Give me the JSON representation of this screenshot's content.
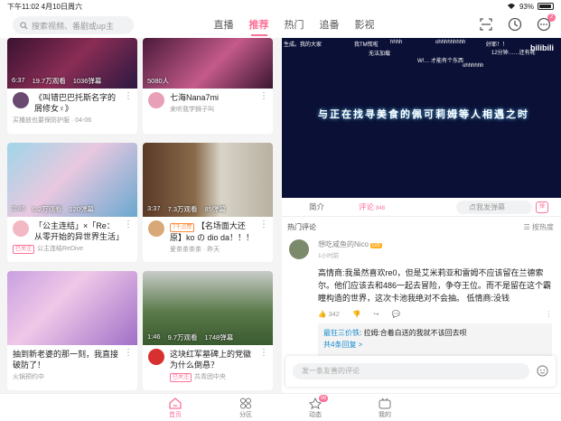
{
  "status_bar": {
    "time_date": "下午11:02   4月10日周六",
    "battery": "93%",
    "battery_level": 0.93
  },
  "search": {
    "placeholder": "搜索视频、番剧或up主"
  },
  "top_tabs": [
    {
      "label": "直播",
      "active": false
    },
    {
      "label": "推荐",
      "active": true
    },
    {
      "label": "热门",
      "active": false
    },
    {
      "label": "追番",
      "active": false
    },
    {
      "label": "影视",
      "active": false
    }
  ],
  "top_icons": {
    "message_badge": "2"
  },
  "feed": [
    {
      "views": "19.7万观看",
      "danmaku": "1036弹幕",
      "duration": "6:37",
      "title": "《叫错巴巴托斯名字的屑修女♀》",
      "sub": "买播放也要保防护服 · 04-06",
      "tag": ""
    },
    {
      "views": "5080人",
      "danmaku": "",
      "duration": "",
      "title": "七海Nana7mi",
      "sub": "来听我学狮子叫",
      "tag": ""
    },
    {
      "views": "6.2万观看",
      "danmaku": "120弹幕",
      "duration": "0:46",
      "title": "「公主连结」×「Re：从零开始的异世界生活」",
      "sub": "公主连结ReDive",
      "tag": "已关注"
    },
    {
      "views": "7.3万观看",
      "danmaku": "85弹幕",
      "duration": "3:37",
      "title": "【名场面大还原】ko の dio da！！！",
      "sub": "爱茶茶茶茶 · 昨天",
      "tag": "7千点赞"
    },
    {
      "views": "",
      "danmaku": "",
      "duration": "",
      "title": "抽到新老婆的那一刻，我直接破防了！",
      "sub": "火锅预约中",
      "tag": ""
    },
    {
      "views": "9.7万观看",
      "danmaku": "1748弹幕",
      "duration": "1:46",
      "title": "这块红军墓碑上的党徽为什么倒悬？",
      "sub": "共青团中央",
      "tag": "已关注"
    }
  ],
  "player": {
    "subtitle": "与正在找寻美食的佩可莉姆等人相遇之时",
    "logo": "bilibili",
    "danmaku": [
      "生成。我的大家",
      "我TM慌啦",
      "hhhh",
      "ohhhhhhhhh",
      "好耶！！",
      "无法加载",
      "12分钟……还有呢",
      "W!… 才能有个东西",
      "ohhhhhh"
    ]
  },
  "player_tabs": {
    "intro": "简介",
    "comments": "评论",
    "comments_count": "848",
    "danmaku_placeholder": "点我发弹幕",
    "danmaku_toggle": "弹"
  },
  "comments": {
    "header": "热门评论",
    "sort": "按热度",
    "items": [
      {
        "user": "想吃咸鱼的Nico",
        "level": "LV5",
        "time": "1小时前",
        "body": "高情商:我虽然喜欢re0，但是艾米莉亚和雷姆不应该留在兰德索尔。他们应该去和486一起去冒险，争夺王位。而不是留在这个霸瞳构造的世界，这次卡池我绝对不会抽。  低情商:没钱",
        "likes": "342"
      }
    ],
    "reply": {
      "user": "最狂三价铁",
      "text": ": 拉姆:合着白送的我就不该回去呗",
      "more": "共4条回复 >"
    }
  },
  "input": {
    "placeholder": "发一条友善的评论"
  },
  "bottom_nav": [
    {
      "label": "首页",
      "active": true
    },
    {
      "label": "分区",
      "active": false
    },
    {
      "label": "动态",
      "active": false,
      "badge": "99"
    },
    {
      "label": "我的",
      "active": false
    }
  ],
  "colors": {
    "accent": "#fb7299"
  }
}
